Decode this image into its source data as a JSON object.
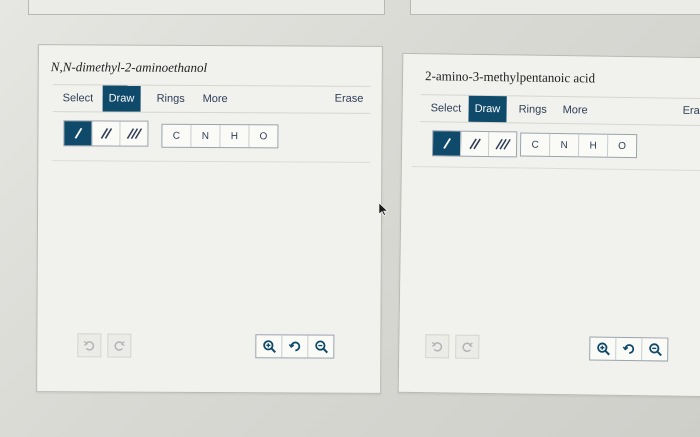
{
  "colors": {
    "accent": "#0f4a6b",
    "text": "#2f3d57"
  },
  "panels": [
    {
      "title": "N,N-dimethyl-2-aminoethanol",
      "tools": [
        "Select",
        "Draw",
        "Rings",
        "More"
      ],
      "active_tool": "Draw",
      "erase": "Erase",
      "bonds": [
        "single-bond-icon",
        "double-bond-icon",
        "triple-bond-icon"
      ],
      "atoms": [
        "C",
        "N",
        "H",
        "O"
      ],
      "history": [
        "undo-icon",
        "redo-icon"
      ],
      "zoom": [
        "zoom-in-icon",
        "zoom-reset-icon",
        "zoom-out-icon"
      ]
    },
    {
      "title": "2-amino-3-methylpentanoic acid",
      "tools": [
        "Select",
        "Draw",
        "Rings",
        "More"
      ],
      "active_tool": "Draw",
      "erase": "Eras",
      "bonds": [
        "single-bond-icon",
        "double-bond-icon",
        "triple-bond-icon"
      ],
      "atoms": [
        "C",
        "N",
        "H",
        "O"
      ],
      "history": [
        "undo-icon",
        "redo-icon"
      ],
      "zoom": [
        "zoom-in-icon",
        "zoom-reset-icon",
        "zoom-out-icon"
      ]
    }
  ]
}
